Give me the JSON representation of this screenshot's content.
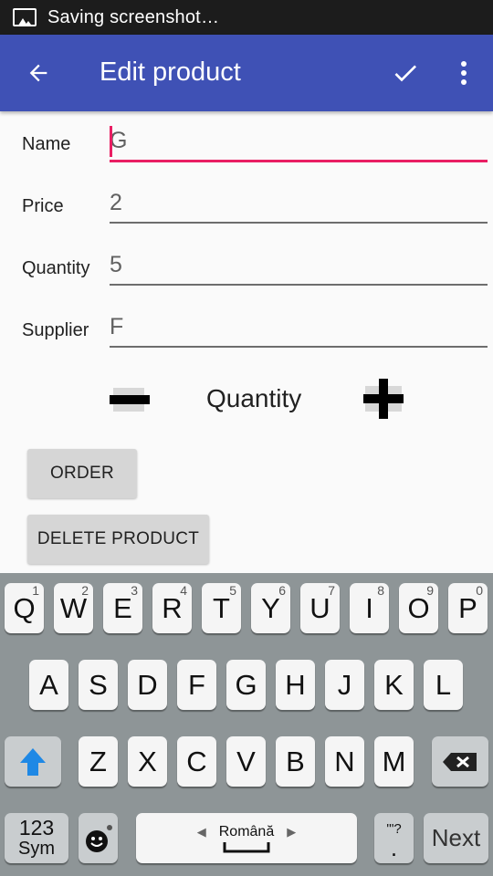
{
  "status_bar": {
    "text": "Saving screenshot…"
  },
  "app_bar": {
    "title": "Edit product"
  },
  "form": {
    "fields": [
      {
        "label": "Name",
        "value": "G"
      },
      {
        "label": "Price",
        "value": "2"
      },
      {
        "label": "Quantity",
        "value": "5"
      },
      {
        "label": "Supplier",
        "value": "F"
      }
    ],
    "quantity_label": "Quantity",
    "order_label": "ORDER",
    "delete_label": "DELETE PRODUCT"
  },
  "keyboard": {
    "row1": [
      {
        "k": "Q",
        "n": "1"
      },
      {
        "k": "W",
        "n": "2"
      },
      {
        "k": "E",
        "n": "3"
      },
      {
        "k": "R",
        "n": "4"
      },
      {
        "k": "T",
        "n": "5"
      },
      {
        "k": "Y",
        "n": "6"
      },
      {
        "k": "U",
        "n": "7"
      },
      {
        "k": "I",
        "n": "8"
      },
      {
        "k": "O",
        "n": "9"
      },
      {
        "k": "P",
        "n": "0"
      }
    ],
    "row2": [
      "A",
      "S",
      "D",
      "F",
      "G",
      "H",
      "J",
      "K",
      "L"
    ],
    "row3": [
      "Z",
      "X",
      "C",
      "V",
      "B",
      "N",
      "M"
    ],
    "sym_label_top": "123",
    "sym_label_bottom": "Sym",
    "space_label": "Română",
    "punct_label": "'\"?",
    "punct_bottom": ".",
    "next_label": "Next"
  },
  "colors": {
    "accent": "#e91e63",
    "primary": "#3f51b5",
    "shift": "#1e88e5"
  }
}
